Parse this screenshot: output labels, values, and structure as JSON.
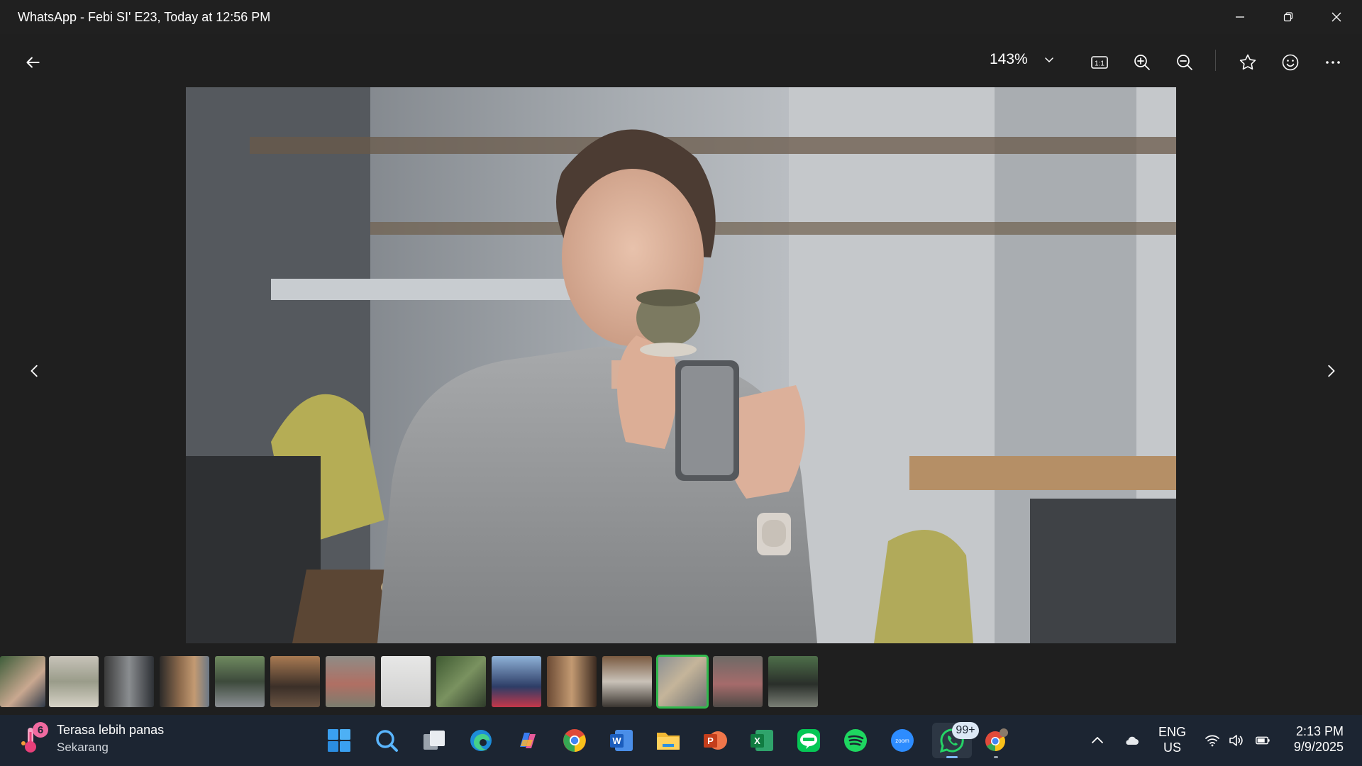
{
  "window": {
    "title": "WhatsApp - Febi SI' E23, Today at 12:56 PM"
  },
  "toolbar": {
    "zoom_value": "143%",
    "actual_size_label": "1:1"
  },
  "filmstrip": {
    "thumb_count": 15,
    "selected_index": 12
  },
  "taskbar": {
    "weather_badge": "6",
    "weather_title": "Terasa lebih panas",
    "weather_subtitle": "Sekarang",
    "apps": [
      "Start",
      "Search",
      "Task View",
      "Microsoft Edge",
      "Copilot",
      "Google Chrome",
      "Microsoft Word",
      "File Explorer",
      "Microsoft PowerPoint",
      "Microsoft Excel",
      "LINE",
      "Spotify",
      "Zoom",
      "WhatsApp",
      "Chrome profile"
    ],
    "whatsapp_badge": "99+",
    "word_letter": "W",
    "ppt_letter": "P",
    "excel_letter": "X",
    "zoom_label": "zoom",
    "lang_top": "ENG",
    "lang_bottom": "US",
    "time": "2:13 PM",
    "date": "9/9/2025"
  },
  "colors": {
    "selected_thumb_border": "#31b94d",
    "taskbar_bg": "#1c2532",
    "window_bg": "#1f1f1f"
  }
}
